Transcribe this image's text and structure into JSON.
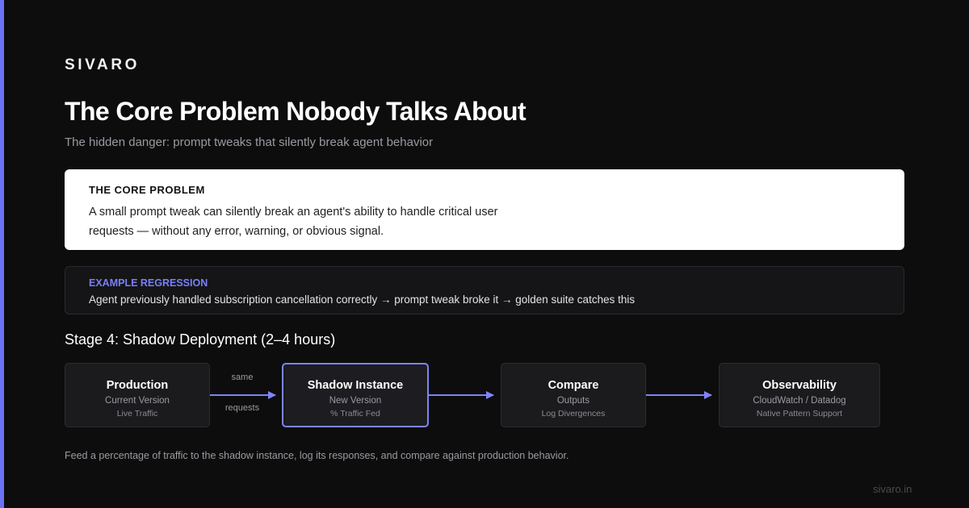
{
  "brand": "SIVARO",
  "title": "The Core Problem Nobody Talks About",
  "subtitle": "The hidden danger: prompt tweaks that silently break agent behavior",
  "core_problem": {
    "label": "THE CORE PROBLEM",
    "text": "A small prompt tweak can silently break an agent's ability to handle critical user requests — without any error, warning, or obvious signal."
  },
  "example": {
    "label": "EXAMPLE REGRESSION",
    "text": "Agent previously handled subscription cancellation correctly → prompt tweak broke it → golden suite catches this"
  },
  "stage": {
    "title": "Stage 4: Shadow Deployment (2–4 hours)",
    "nodes": [
      {
        "title": "Production",
        "sub": "Current Version",
        "sub2": "Live Traffic"
      },
      {
        "title": "Shadow Instance",
        "sub": "New Version",
        "sub2": "% Traffic Fed"
      },
      {
        "title": "Compare",
        "sub": "Outputs",
        "sub2": "Log Divergences"
      },
      {
        "title": "Observability",
        "sub": "CloudWatch / Datadog",
        "sub2": "Native Pattern Support"
      }
    ],
    "edge_label_top": "same",
    "edge_label_bottom": "requests",
    "accent_color": "#7f84f7"
  },
  "caption": "Feed a percentage of traffic to the shadow instance, log its responses, and compare against production behavior.",
  "footer": "sivaro.in"
}
